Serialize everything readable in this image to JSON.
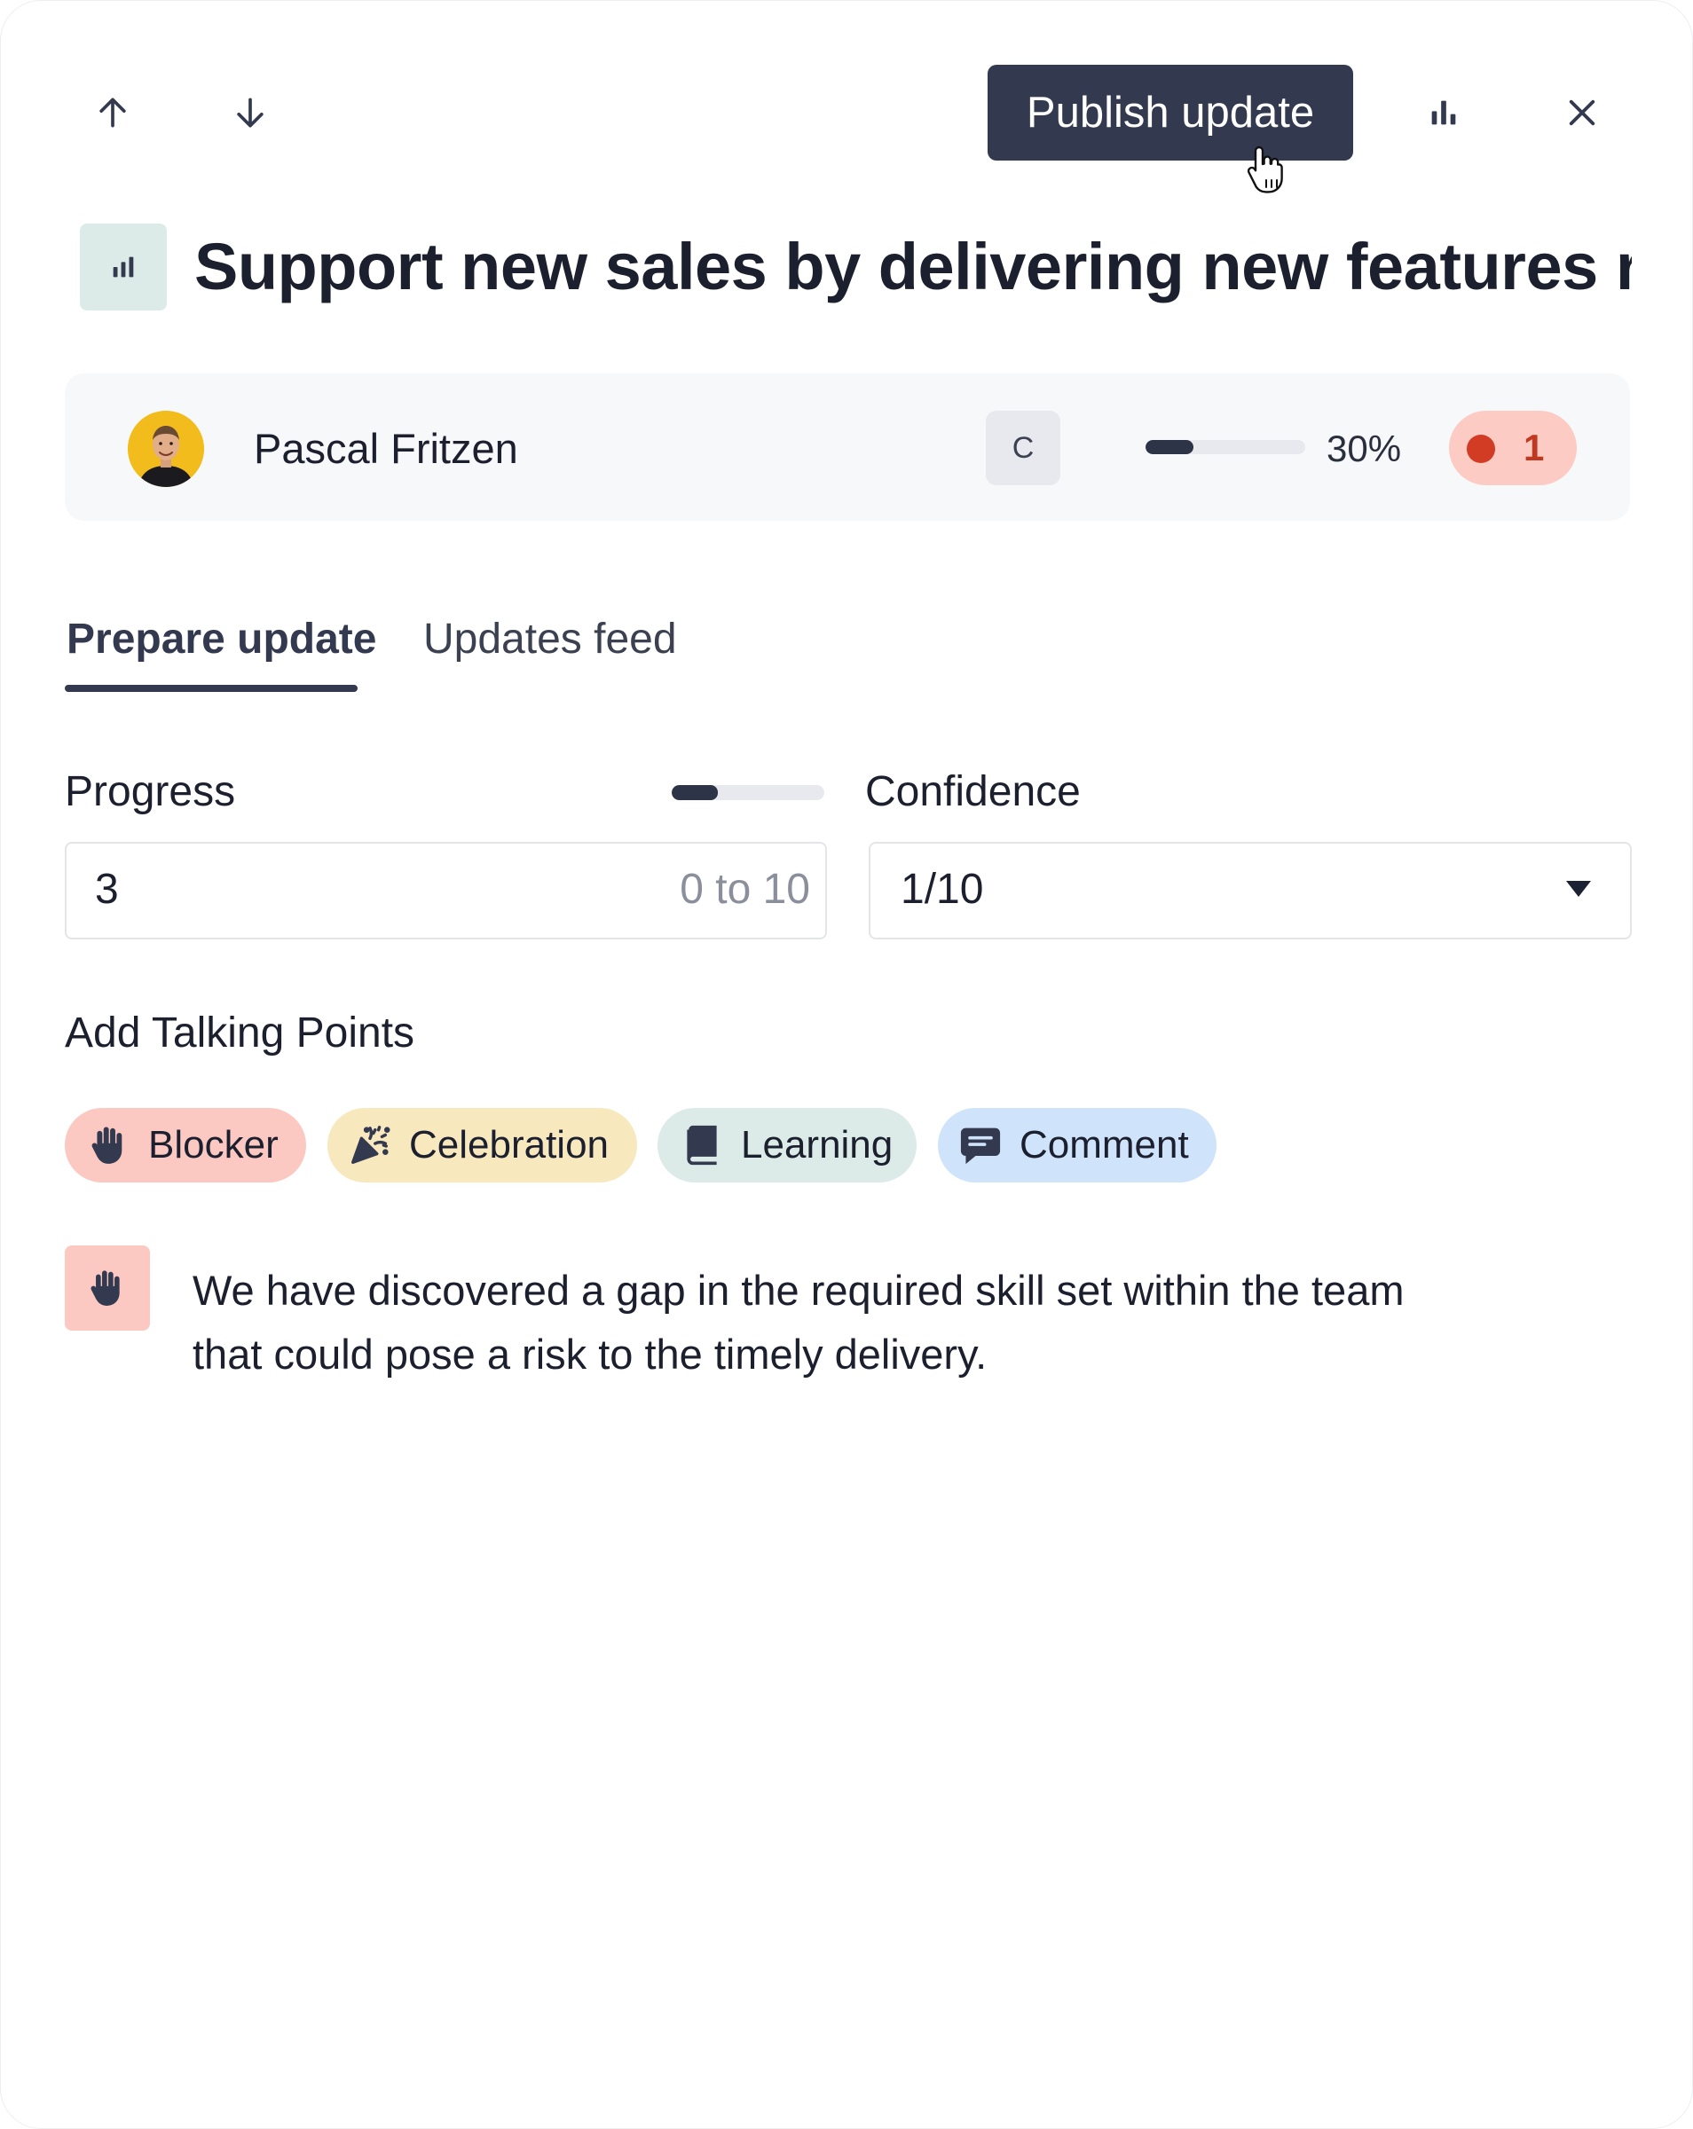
{
  "toolbar": {
    "publish_label": "Publish update",
    "icons": [
      "arrow-up-icon",
      "arrow-down-icon",
      "bar-chart-icon",
      "close-icon"
    ]
  },
  "objective": {
    "icon": "bar-chart-icon",
    "title": "Support new sales by delivering new features req..."
  },
  "owner": {
    "name": "Pascal Fritzen",
    "grade_badge": "C",
    "progress_fraction": 0.3,
    "progress_label": "30%",
    "risk_count": "1",
    "risk_color": "#d23c24"
  },
  "tabs": [
    {
      "label": "Prepare update",
      "active": true
    },
    {
      "label": "Updates feed",
      "active": false
    }
  ],
  "form": {
    "progress_label": "Progress",
    "progress_value": "3",
    "progress_placeholder": "0 to 10",
    "progress_fraction": 0.3,
    "confidence_label": "Confidence",
    "confidence_value": "1/10"
  },
  "talking_points": {
    "heading": "Add Talking Points",
    "chips": [
      {
        "label": "Blocker",
        "icon": "hand-icon",
        "color": "#fbc9c1"
      },
      {
        "label": "Celebration",
        "icon": "party-popper-icon",
        "color": "#f7e8be"
      },
      {
        "label": "Learning",
        "icon": "book-icon",
        "color": "#dcebe7"
      },
      {
        "label": "Comment",
        "icon": "comment-icon",
        "color": "#cfe4fb"
      }
    ]
  },
  "entries": [
    {
      "type": "Blocker",
      "icon": "hand-icon",
      "text": "We have discovered a gap in the required skill set within the  team that could pose a risk to the timely delivery."
    }
  ],
  "colors": {
    "primary": "#33394f",
    "accent_red": "#d23c24"
  }
}
